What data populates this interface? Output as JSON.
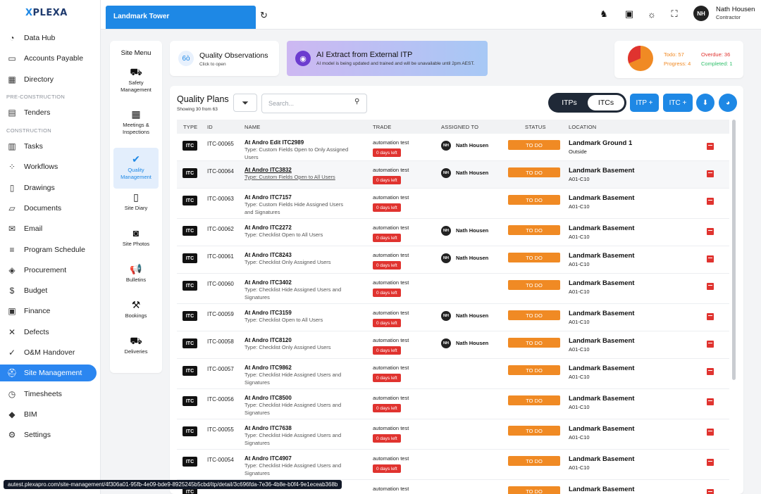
{
  "app": {
    "logo": "PLEXA",
    "logo_mark": "X"
  },
  "nav": {
    "items": [
      {
        "label": "Data Hub",
        "icon": "pie-chart-icon",
        "glyph": "◔"
      },
      {
        "label": "Accounts Payable",
        "icon": "inbox-icon",
        "glyph": "▭"
      },
      {
        "label": "Directory",
        "icon": "directory-icon",
        "glyph": "▦"
      }
    ],
    "section_pre": "PRE-CONSTRUCTION",
    "items_pre": [
      {
        "label": "Tenders",
        "icon": "calculator-icon",
        "glyph": "▤"
      }
    ],
    "section_con": "CONSTRUCTION",
    "items_con": [
      {
        "label": "Tasks",
        "icon": "kanban-icon",
        "glyph": "▥"
      },
      {
        "label": "Workflows",
        "icon": "workflow-icon",
        "glyph": "⁘"
      },
      {
        "label": "Drawings",
        "icon": "map-icon",
        "glyph": "▯"
      },
      {
        "label": "Documents",
        "icon": "folder-icon",
        "glyph": "▱"
      },
      {
        "label": "Email",
        "icon": "envelope-icon",
        "glyph": "✉"
      },
      {
        "label": "Program Schedule",
        "icon": "gantt-icon",
        "glyph": "≡"
      },
      {
        "label": "Procurement",
        "icon": "layers-icon",
        "glyph": "◈"
      },
      {
        "label": "Budget",
        "icon": "dollar-icon",
        "glyph": "$"
      },
      {
        "label": "Finance",
        "icon": "finance-icon",
        "glyph": "▣"
      },
      {
        "label": "Defects",
        "icon": "tools-icon",
        "glyph": "✕"
      },
      {
        "label": "O&M Handover",
        "icon": "check-circle-icon",
        "glyph": "✓"
      },
      {
        "label": "Site Management",
        "icon": "hardhat-icon",
        "glyph": "⛑"
      },
      {
        "label": "Timesheets",
        "icon": "clock-icon",
        "glyph": "◷"
      },
      {
        "label": "BIM",
        "icon": "cube-icon",
        "glyph": "◆"
      },
      {
        "label": "Settings",
        "icon": "gear-icon",
        "glyph": "⚙"
      }
    ]
  },
  "header": {
    "project": "Landmark Tower",
    "user_initials": "NH",
    "user_name": "Nath Housen",
    "user_role": "Contractor"
  },
  "site_menu": {
    "title": "Site Menu",
    "items": [
      {
        "label": "Safety Management",
        "icon": "truck-icon",
        "glyph": "⛟"
      },
      {
        "label": "Meetings & Inspections",
        "icon": "calendar-icon",
        "glyph": "▦"
      },
      {
        "label": "Quality Management",
        "icon": "shield-check-icon",
        "glyph": "✔"
      },
      {
        "label": "Site Diary",
        "icon": "book-icon",
        "glyph": "▯"
      },
      {
        "label": "Site Photos",
        "icon": "camera-icon",
        "glyph": "◙"
      },
      {
        "label": "Bulletins",
        "icon": "megaphone-icon",
        "glyph": "📢"
      },
      {
        "label": "Bookings",
        "icon": "crane-icon",
        "glyph": "⚒"
      },
      {
        "label": "Deliveries",
        "icon": "delivery-truck-icon",
        "glyph": "⛟"
      }
    ]
  },
  "quality_observations": {
    "title": "Quality Observations",
    "subtitle": "Click to open",
    "glyph": "6ò"
  },
  "ai_extract": {
    "title": "AI Extract from External ITP",
    "subtitle": "AI model is being updated and trained and will be unavailable until 2pm AEST.",
    "glyph": "◉"
  },
  "stats": {
    "todo": "Todo: 57",
    "progress": "Progress: 4",
    "overdue": "Overdue: 36",
    "completed": "Completed: 1",
    "colors": {
      "todo": "#f08a24",
      "overdue": "#e0332f",
      "progress": "#f08a24",
      "completed": "#2ebf6a"
    }
  },
  "quality_plans": {
    "title": "Quality Plans",
    "showing": "Showing 30 from 63",
    "search_placeholder": "Search...",
    "toggle": {
      "itps": "ITPs",
      "itcs": "ITCs"
    },
    "btn_itp": "ITP  +",
    "btn_itc": "ITC  +",
    "columns": {
      "type": "TYPE",
      "id": "ID",
      "name": "NAME",
      "trade": "TRADE",
      "assigned": "ASSIGNED TO",
      "status": "STATUS",
      "location": "LOCATION"
    },
    "rows": [
      {
        "type": "ITC",
        "id": "ITC-00065",
        "name": "At Andro Edit ITC2989",
        "sub": "Type: Custom Fields Open to Only Assigned Users",
        "trade": "automation test",
        "days": "0 days left",
        "assigned_initials": "NH",
        "assigned": "Nath Housen",
        "status": "TO DO",
        "loc": "Landmark Ground 1",
        "loc_sub": "Outside"
      },
      {
        "type": "ITC",
        "id": "ITC-00064",
        "name": "At Andro ITC3832",
        "sub": "Type: Custom Fields Open to All Users",
        "trade": "automation test",
        "days": "0 days left",
        "assigned_initials": "NH",
        "assigned": "Nath Housen",
        "status": "TO DO",
        "loc": "Landmark Basement",
        "loc_sub": "A01-C10"
      },
      {
        "type": "ITC",
        "id": "ITC-00063",
        "name": "At Andro ITC7157",
        "sub": "Type: Custom Fields Hide Assigned Users and Signatures",
        "trade": "automation test",
        "days": "0 days left",
        "assigned_initials": "",
        "assigned": "",
        "status": "TO DO",
        "loc": "Landmark Basement",
        "loc_sub": "A01-C10"
      },
      {
        "type": "ITC",
        "id": "ITC-00062",
        "name": "At Andro ITC2272",
        "sub": "Type: Checklist Open to All Users",
        "trade": "automation test",
        "days": "0 days left",
        "assigned_initials": "NH",
        "assigned": "Nath Housen",
        "status": "TO DO",
        "loc": "Landmark Basement",
        "loc_sub": "A01-C10"
      },
      {
        "type": "ITC",
        "id": "ITC-00061",
        "name": "At Andro ITC8243",
        "sub": "Type: Checklist Only Assigned Users",
        "trade": "automation test",
        "days": "0 days left",
        "assigned_initials": "NH",
        "assigned": "Nath Housen",
        "status": "TO DO",
        "loc": "Landmark Basement",
        "loc_sub": "A01-C10"
      },
      {
        "type": "ITC",
        "id": "ITC-00060",
        "name": "At Andro ITC3402",
        "sub": "Type: Checklist Hide Assigned Users and Signatures",
        "trade": "automation test",
        "days": "0 days left",
        "assigned_initials": "",
        "assigned": "",
        "status": "TO DO",
        "loc": "Landmark Basement",
        "loc_sub": "A01-C10"
      },
      {
        "type": "ITC",
        "id": "ITC-00059",
        "name": "At Andro ITC3159",
        "sub": "Type: Checklist Open to All Users",
        "trade": "automation test",
        "days": "0 days left",
        "assigned_initials": "NH",
        "assigned": "Nath Housen",
        "status": "TO DO",
        "loc": "Landmark Basement",
        "loc_sub": "A01-C10"
      },
      {
        "type": "ITC",
        "id": "ITC-00058",
        "name": "At Andro ITC8120",
        "sub": "Type: Checklist Only Assigned Users",
        "trade": "automation test",
        "days": "0 days left",
        "assigned_initials": "NH",
        "assigned": "Nath Housen",
        "status": "TO DO",
        "loc": "Landmark Basement",
        "loc_sub": "A01-C10"
      },
      {
        "type": "ITC",
        "id": "ITC-00057",
        "name": "At Andro ITC9862",
        "sub": "Type: Checklist Hide Assigned Users and Signatures",
        "trade": "automation test",
        "days": "0 days left",
        "assigned_initials": "",
        "assigned": "",
        "status": "TO DO",
        "loc": "Landmark Basement",
        "loc_sub": "A01-C10"
      },
      {
        "type": "ITC",
        "id": "ITC-00056",
        "name": "At Andro ITC8500",
        "sub": "Type: Checklist Hide Assigned Users and Signatures",
        "trade": "automation test",
        "days": "0 days left",
        "assigned_initials": "",
        "assigned": "",
        "status": "TO DO",
        "loc": "Landmark Basement",
        "loc_sub": "A01-C10"
      },
      {
        "type": "ITC",
        "id": "ITC-00055",
        "name": "At Andro ITC7638",
        "sub": "Type: Checklist Hide Assigned Users and Signatures",
        "trade": "automation test",
        "days": "0 days left",
        "assigned_initials": "",
        "assigned": "",
        "status": "TO DO",
        "loc": "Landmark Basement",
        "loc_sub": "A01-C10"
      },
      {
        "type": "ITC",
        "id": "ITC-00054",
        "name": "At Andro ITC4907",
        "sub": "Type: Checklist Hide Assigned Users and Signatures",
        "trade": "automation test",
        "days": "0 days left",
        "assigned_initials": "",
        "assigned": "",
        "status": "TO DO",
        "loc": "Landmark Basement",
        "loc_sub": "A01-C10"
      },
      {
        "type": "ITC",
        "id": "",
        "name": "",
        "sub": "",
        "trade": "automation test",
        "days": "",
        "assigned_initials": "",
        "assigned": "",
        "status": "TO DO",
        "loc": "Landmark Basement",
        "loc_sub": ""
      }
    ]
  },
  "status_url": "autest.plexapro.com/site-management/4f306a01-95fb-4e09-bde9-8925245b5cbd/itp/detail/3c696fda-7e36-4b8e-b0f4-9e1eceab368b"
}
